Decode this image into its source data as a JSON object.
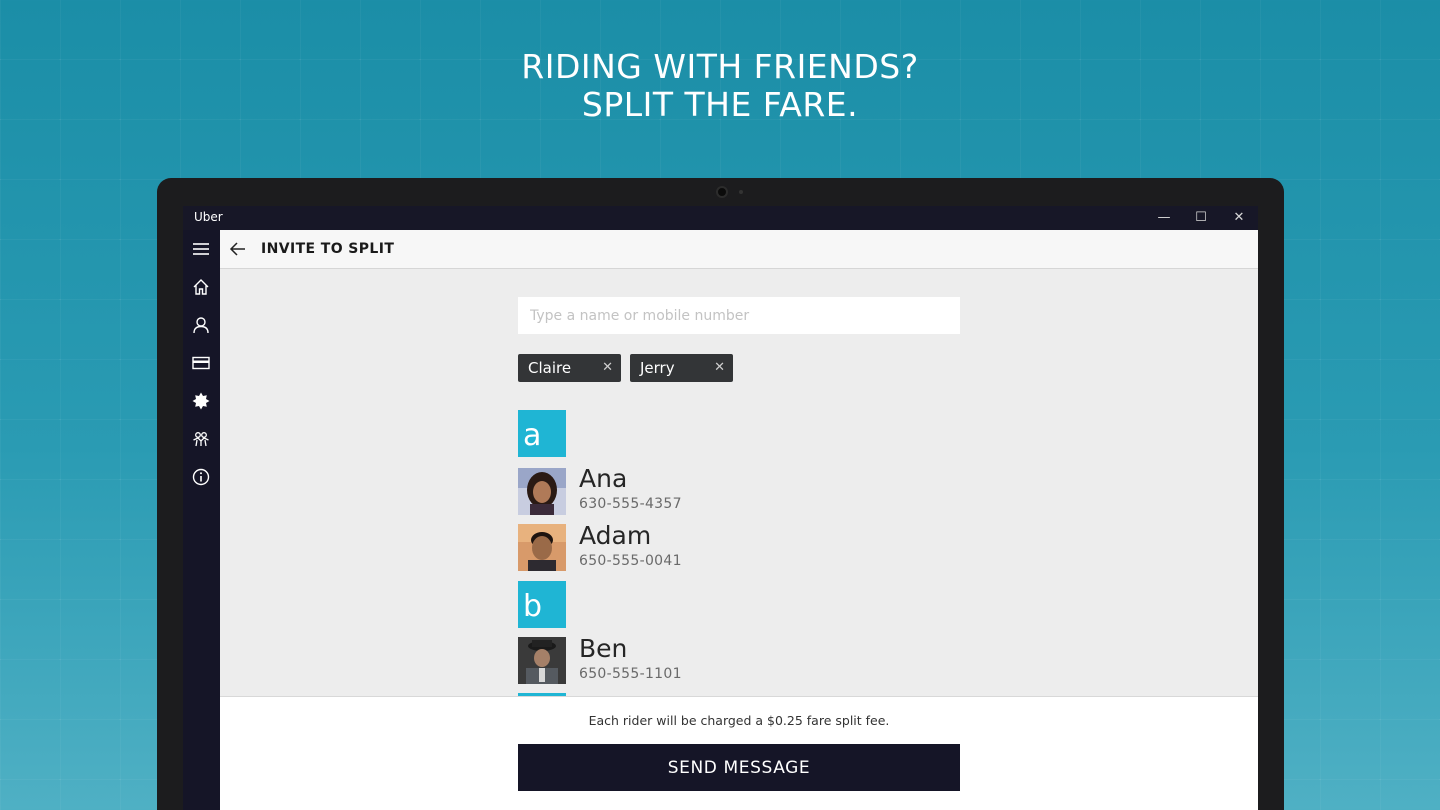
{
  "promo": {
    "line1": "RIDING WITH FRIENDS?",
    "line2": "SPLIT THE FARE."
  },
  "window": {
    "app_title": "Uber",
    "minimize": "—",
    "maximize": "☐",
    "close": "✕"
  },
  "sidebar": {
    "items": [
      {
        "icon": "menu-icon"
      },
      {
        "icon": "home-icon"
      },
      {
        "icon": "profile-icon"
      },
      {
        "icon": "payment-icon"
      },
      {
        "icon": "promotions-icon"
      },
      {
        "icon": "free-rides-icon"
      },
      {
        "icon": "about-icon"
      }
    ]
  },
  "header": {
    "title": "INVITE TO SPLIT"
  },
  "search": {
    "placeholder": "Type a name or mobile number",
    "value": ""
  },
  "selected": [
    {
      "name": "Claire",
      "remove": "✕"
    },
    {
      "name": "Jerry",
      "remove": "✕"
    }
  ],
  "groups": [
    {
      "letter": "a",
      "contacts": [
        {
          "name": "Ana",
          "phone": "630-555-4357"
        },
        {
          "name": "Adam",
          "phone": "650-555-0041"
        }
      ]
    },
    {
      "letter": "b",
      "contacts": [
        {
          "name": "Ben",
          "phone": "650-555-1101"
        }
      ]
    }
  ],
  "footer": {
    "note": "Each rider will be charged a $0.25 fare split fee.",
    "button": "SEND MESSAGE"
  },
  "colors": {
    "accent": "#1fb5d4",
    "dark": "#151527",
    "chip": "#333537"
  }
}
